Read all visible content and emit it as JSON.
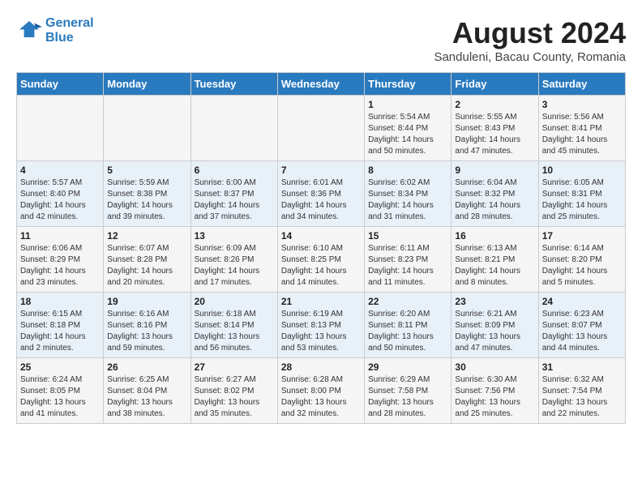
{
  "header": {
    "logo_line1": "General",
    "logo_line2": "Blue",
    "main_title": "August 2024",
    "subtitle": "Sanduleni, Bacau County, Romania"
  },
  "days_of_week": [
    "Sunday",
    "Monday",
    "Tuesday",
    "Wednesday",
    "Thursday",
    "Friday",
    "Saturday"
  ],
  "weeks": [
    [
      {
        "day": "",
        "info": ""
      },
      {
        "day": "",
        "info": ""
      },
      {
        "day": "",
        "info": ""
      },
      {
        "day": "",
        "info": ""
      },
      {
        "day": "1",
        "info": "Sunrise: 5:54 AM\nSunset: 8:44 PM\nDaylight: 14 hours\nand 50 minutes."
      },
      {
        "day": "2",
        "info": "Sunrise: 5:55 AM\nSunset: 8:43 PM\nDaylight: 14 hours\nand 47 minutes."
      },
      {
        "day": "3",
        "info": "Sunrise: 5:56 AM\nSunset: 8:41 PM\nDaylight: 14 hours\nand 45 minutes."
      }
    ],
    [
      {
        "day": "4",
        "info": "Sunrise: 5:57 AM\nSunset: 8:40 PM\nDaylight: 14 hours\nand 42 minutes."
      },
      {
        "day": "5",
        "info": "Sunrise: 5:59 AM\nSunset: 8:38 PM\nDaylight: 14 hours\nand 39 minutes."
      },
      {
        "day": "6",
        "info": "Sunrise: 6:00 AM\nSunset: 8:37 PM\nDaylight: 14 hours\nand 37 minutes."
      },
      {
        "day": "7",
        "info": "Sunrise: 6:01 AM\nSunset: 8:36 PM\nDaylight: 14 hours\nand 34 minutes."
      },
      {
        "day": "8",
        "info": "Sunrise: 6:02 AM\nSunset: 8:34 PM\nDaylight: 14 hours\nand 31 minutes."
      },
      {
        "day": "9",
        "info": "Sunrise: 6:04 AM\nSunset: 8:32 PM\nDaylight: 14 hours\nand 28 minutes."
      },
      {
        "day": "10",
        "info": "Sunrise: 6:05 AM\nSunset: 8:31 PM\nDaylight: 14 hours\nand 25 minutes."
      }
    ],
    [
      {
        "day": "11",
        "info": "Sunrise: 6:06 AM\nSunset: 8:29 PM\nDaylight: 14 hours\nand 23 minutes."
      },
      {
        "day": "12",
        "info": "Sunrise: 6:07 AM\nSunset: 8:28 PM\nDaylight: 14 hours\nand 20 minutes."
      },
      {
        "day": "13",
        "info": "Sunrise: 6:09 AM\nSunset: 8:26 PM\nDaylight: 14 hours\nand 17 minutes."
      },
      {
        "day": "14",
        "info": "Sunrise: 6:10 AM\nSunset: 8:25 PM\nDaylight: 14 hours\nand 14 minutes."
      },
      {
        "day": "15",
        "info": "Sunrise: 6:11 AM\nSunset: 8:23 PM\nDaylight: 14 hours\nand 11 minutes."
      },
      {
        "day": "16",
        "info": "Sunrise: 6:13 AM\nSunset: 8:21 PM\nDaylight: 14 hours\nand 8 minutes."
      },
      {
        "day": "17",
        "info": "Sunrise: 6:14 AM\nSunset: 8:20 PM\nDaylight: 14 hours\nand 5 minutes."
      }
    ],
    [
      {
        "day": "18",
        "info": "Sunrise: 6:15 AM\nSunset: 8:18 PM\nDaylight: 14 hours\nand 2 minutes."
      },
      {
        "day": "19",
        "info": "Sunrise: 6:16 AM\nSunset: 8:16 PM\nDaylight: 13 hours\nand 59 minutes."
      },
      {
        "day": "20",
        "info": "Sunrise: 6:18 AM\nSunset: 8:14 PM\nDaylight: 13 hours\nand 56 minutes."
      },
      {
        "day": "21",
        "info": "Sunrise: 6:19 AM\nSunset: 8:13 PM\nDaylight: 13 hours\nand 53 minutes."
      },
      {
        "day": "22",
        "info": "Sunrise: 6:20 AM\nSunset: 8:11 PM\nDaylight: 13 hours\nand 50 minutes."
      },
      {
        "day": "23",
        "info": "Sunrise: 6:21 AM\nSunset: 8:09 PM\nDaylight: 13 hours\nand 47 minutes."
      },
      {
        "day": "24",
        "info": "Sunrise: 6:23 AM\nSunset: 8:07 PM\nDaylight: 13 hours\nand 44 minutes."
      }
    ],
    [
      {
        "day": "25",
        "info": "Sunrise: 6:24 AM\nSunset: 8:05 PM\nDaylight: 13 hours\nand 41 minutes."
      },
      {
        "day": "26",
        "info": "Sunrise: 6:25 AM\nSunset: 8:04 PM\nDaylight: 13 hours\nand 38 minutes."
      },
      {
        "day": "27",
        "info": "Sunrise: 6:27 AM\nSunset: 8:02 PM\nDaylight: 13 hours\nand 35 minutes."
      },
      {
        "day": "28",
        "info": "Sunrise: 6:28 AM\nSunset: 8:00 PM\nDaylight: 13 hours\nand 32 minutes."
      },
      {
        "day": "29",
        "info": "Sunrise: 6:29 AM\nSunset: 7:58 PM\nDaylight: 13 hours\nand 28 minutes."
      },
      {
        "day": "30",
        "info": "Sunrise: 6:30 AM\nSunset: 7:56 PM\nDaylight: 13 hours\nand 25 minutes."
      },
      {
        "day": "31",
        "info": "Sunrise: 6:32 AM\nSunset: 7:54 PM\nDaylight: 13 hours\nand 22 minutes."
      }
    ]
  ]
}
